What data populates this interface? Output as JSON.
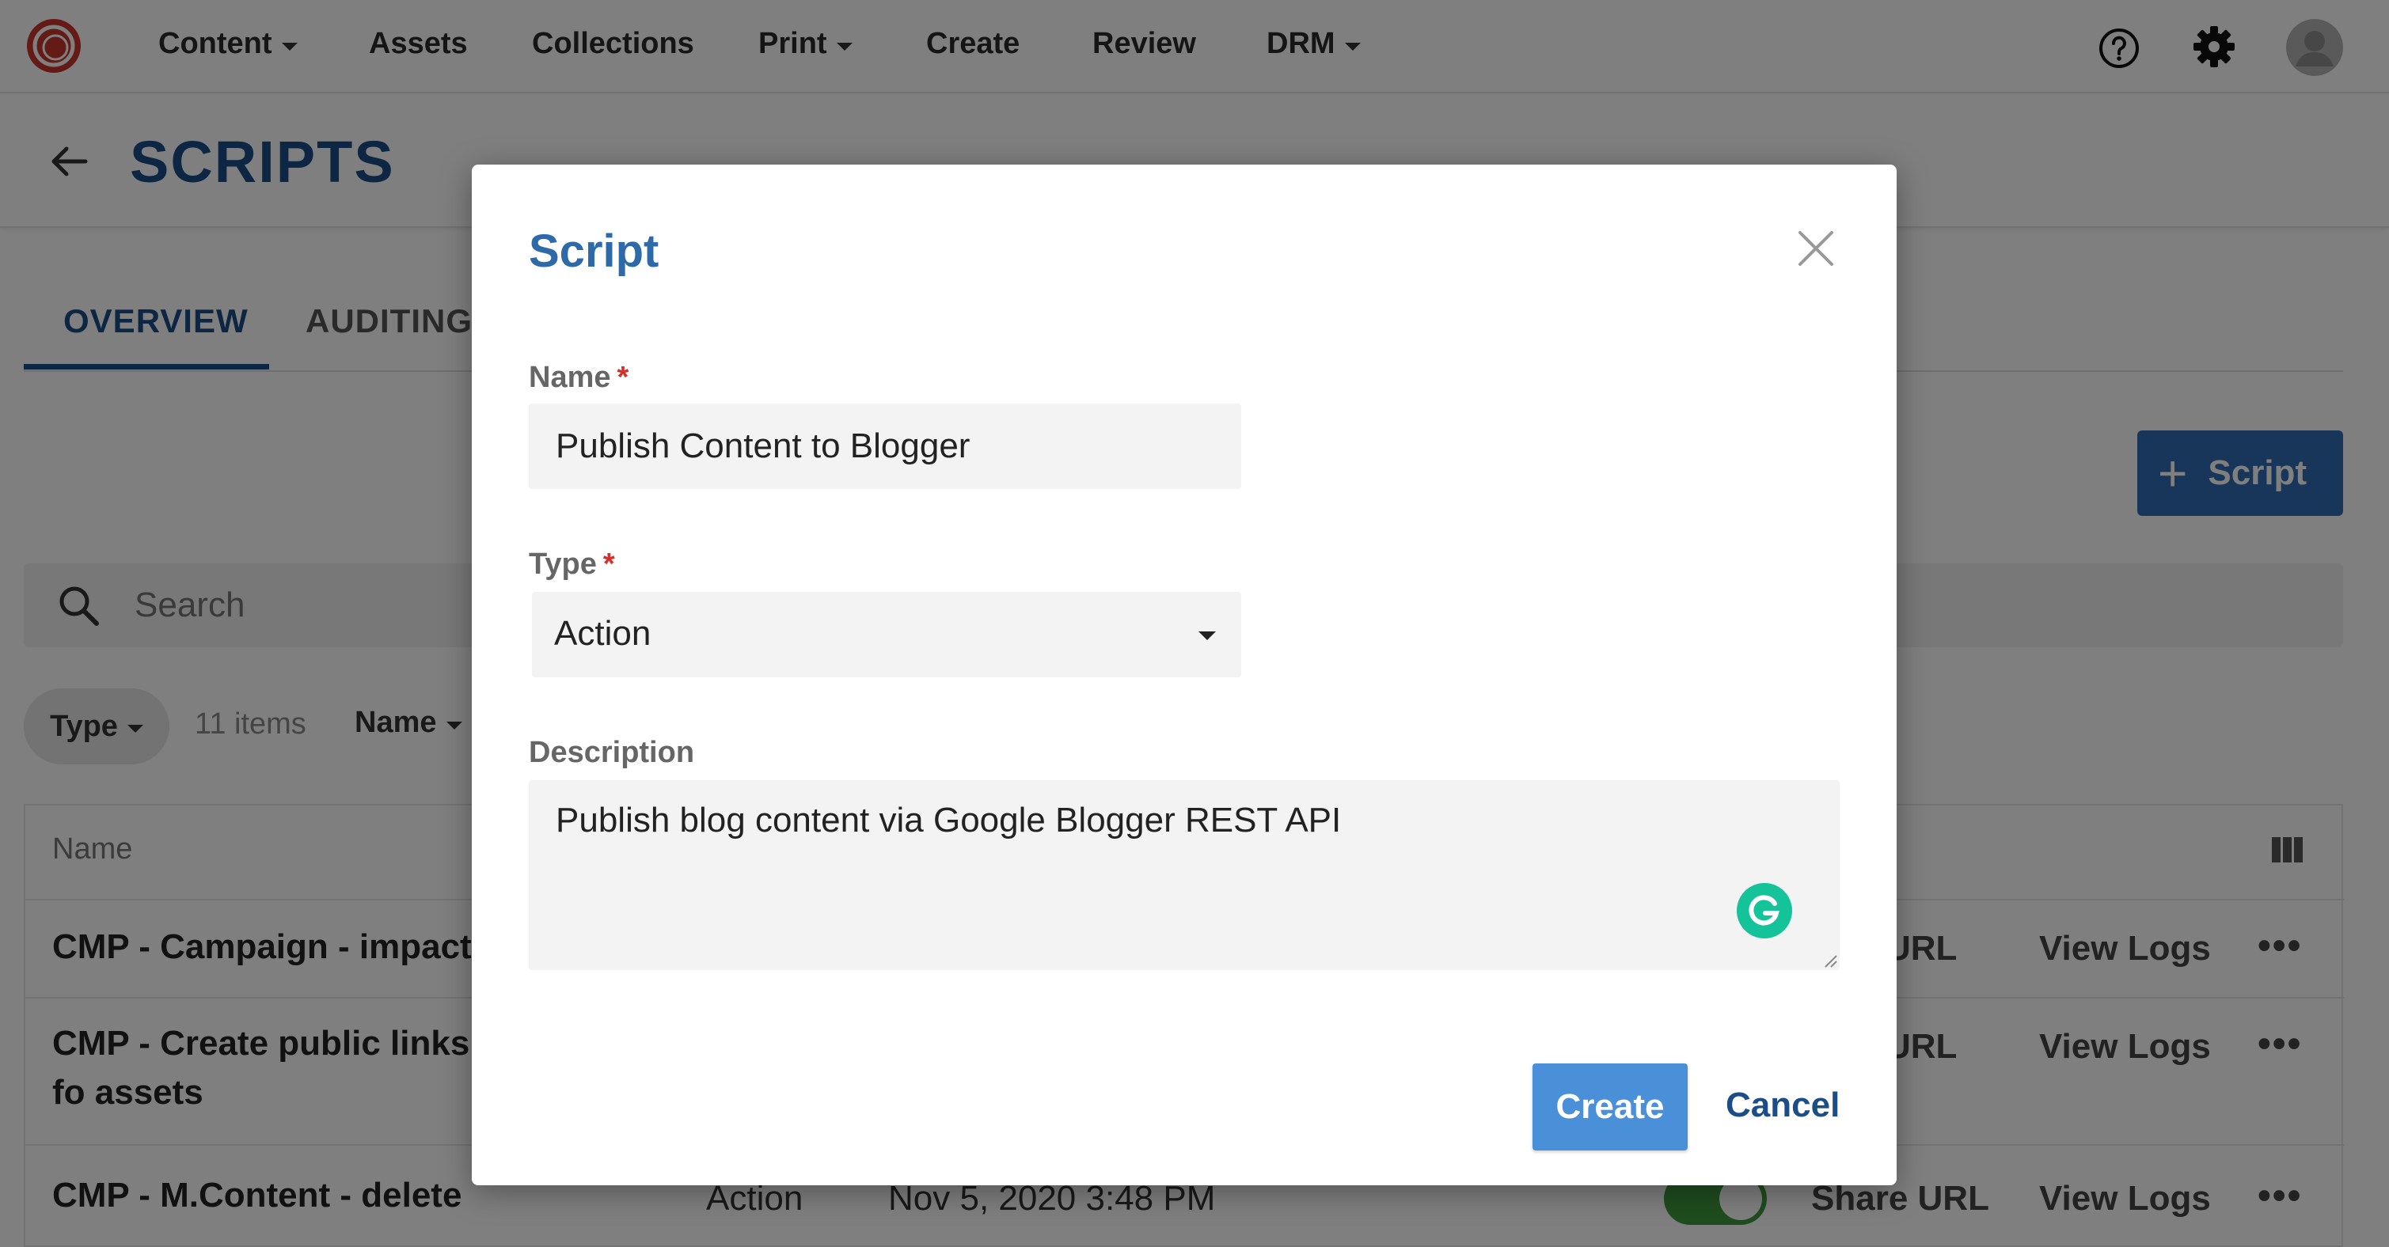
{
  "nav": {
    "items": [
      {
        "label": "Content",
        "dropdown": true
      },
      {
        "label": "Assets",
        "dropdown": false
      },
      {
        "label": "Collections",
        "dropdown": false
      },
      {
        "label": "Print",
        "dropdown": true
      },
      {
        "label": "Create",
        "dropdown": false
      },
      {
        "label": "Review",
        "dropdown": false
      },
      {
        "label": "DRM",
        "dropdown": true
      }
    ],
    "icons": [
      "logo-icon",
      "help-icon",
      "gear-icon",
      "avatar-icon"
    ]
  },
  "page": {
    "title": "SCRIPTS",
    "tabs": [
      "OVERVIEW",
      "AUDITING"
    ],
    "add_button_label": "Script",
    "search_placeholder": "Search",
    "filters": {
      "type_label": "Type",
      "items_count": "11 items",
      "sort_label": "Name"
    },
    "table": {
      "header_name": "Name",
      "rows": [
        {
          "name": "CMP - Campaign - impact",
          "type": "",
          "date": "",
          "share": "URL",
          "logs": "View Logs",
          "more": "•••"
        },
        {
          "name": "CMP - Create public links fo assets",
          "type": "",
          "date": "",
          "share": "URL",
          "logs": "View Logs",
          "more": "•••"
        },
        {
          "name": "CMP - M.Content - delete",
          "type": "Action",
          "date": "Nov 5, 2020 3:48 PM",
          "share": "Share URL",
          "logs": "View Logs",
          "more": "•••"
        }
      ]
    }
  },
  "modal": {
    "title": "Script",
    "name_label": "Name",
    "name_value": "Publish Content to Blogger",
    "type_label": "Type",
    "type_value": "Action",
    "description_label": "Description",
    "description_value": "Publish blog content via Google Blogger REST API",
    "required_marker": "*",
    "create_label": "Create",
    "cancel_label": "Cancel"
  },
  "colors": {
    "brand_blue": "#1b4d86",
    "modal_title": "#2e6aa8",
    "primary_button": "#4a90d9",
    "required": "#d0312d",
    "logo_red": "#c8352b"
  }
}
